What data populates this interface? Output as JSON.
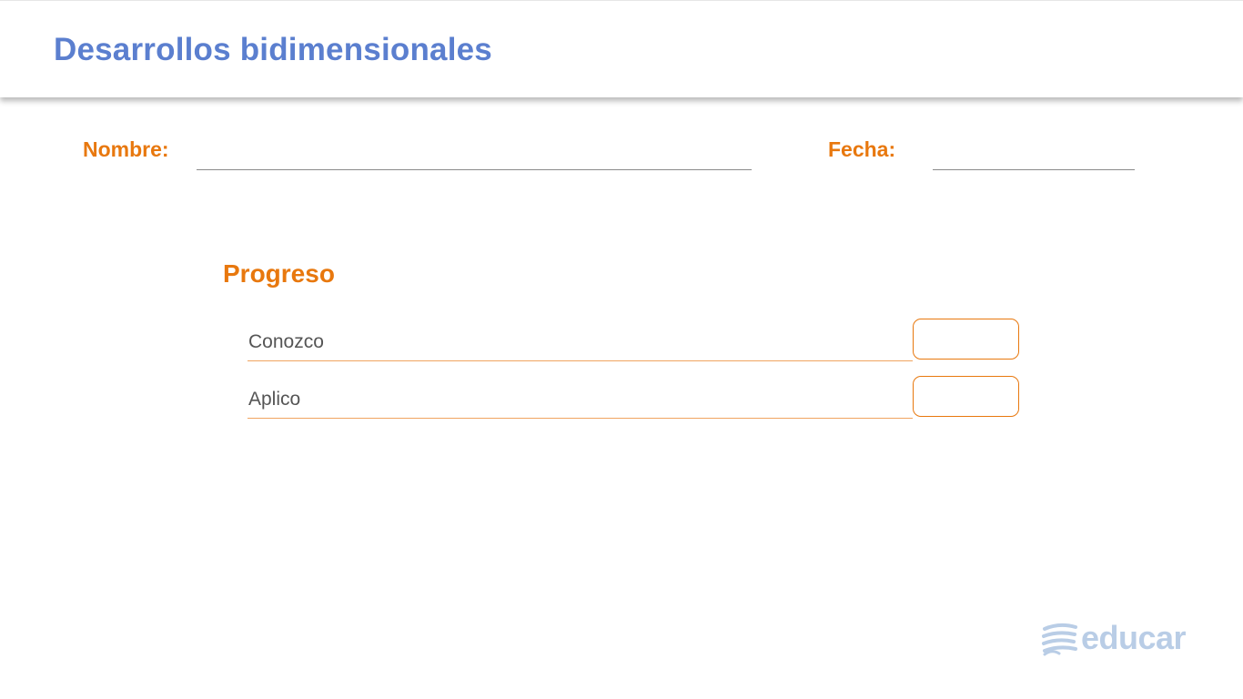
{
  "header": {
    "title": "Desarrollos bidimensionales"
  },
  "form": {
    "name_label": "Nombre:",
    "name_value": "",
    "date_label": "Fecha:",
    "date_value": ""
  },
  "progress": {
    "title": "Progreso",
    "items": [
      {
        "label": "Conozco",
        "value": ""
      },
      {
        "label": "Aplico",
        "value": ""
      }
    ]
  },
  "brand": {
    "logo_icon": "educar-logo-icon",
    "logo_text": "educar",
    "logo_color": "#b9cde6"
  },
  "colors": {
    "title": "#5b7fcf",
    "accent": "#e8780e",
    "text": "#555555"
  }
}
